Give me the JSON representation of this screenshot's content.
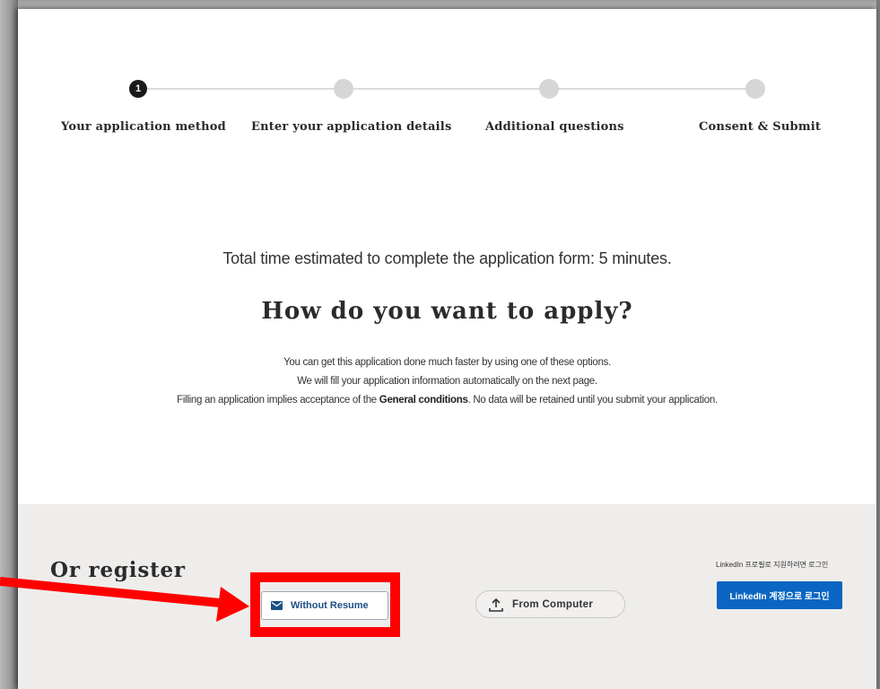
{
  "stepper": {
    "steps": [
      {
        "label": "Your application method",
        "number": "1",
        "active": true
      },
      {
        "label": "Enter your application details",
        "active": false
      },
      {
        "label": "Additional questions",
        "active": false
      },
      {
        "label": "Consent & Submit",
        "active": false
      }
    ]
  },
  "main": {
    "estimate": "Total time estimated to complete the application form: 5 minutes.",
    "headline": "How do you want to apply?",
    "desc_line1": "You can get this application done much faster by using one of these options.",
    "desc_line2": "We will fill your application information automatically on the next page.",
    "desc_line3_pre": "Filling an application implies acceptance of the ",
    "desc_line3_bold": "General conditions",
    "desc_line3_post": ". No data will be retained until you submit your application."
  },
  "register": {
    "title": "Or register",
    "without_resume_label": "Without Resume",
    "from_computer_label": "From Computer",
    "linkedin_hint": "LinkedIn 프로필로 지원하려면 로그인",
    "linkedin_button_label": "LinkedIn 계정으로 로그인"
  },
  "icons": {
    "without_resume": "mail-icon",
    "from_computer": "upload-icon"
  },
  "colors": {
    "active_step": "#1a1a1a",
    "inactive_step": "#d6d6d6",
    "linkedin_blue": "#0a66c2",
    "annotation_red": "#ff0000",
    "register_bg": "#efedeb"
  }
}
